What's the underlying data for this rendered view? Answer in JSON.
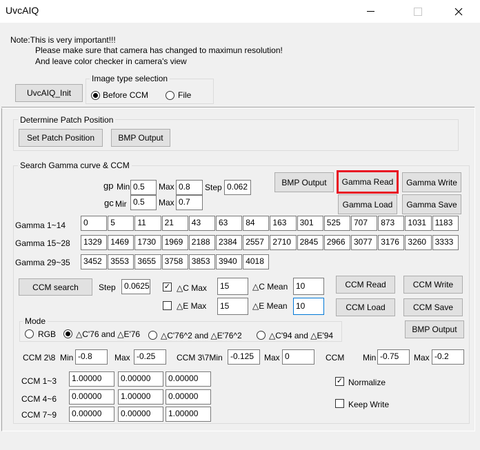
{
  "window": {
    "title": "UvcAIQ"
  },
  "note": {
    "line1": "Note:This is very important!!!",
    "line2": "Please make sure that camera has changed to maximun resolution!",
    "line3": "And leave color checker in camera's view"
  },
  "init_button": "UvcAIQ_Init",
  "image_type": {
    "title": "Image type selection",
    "before_ccm": "Before CCM",
    "file": "File"
  },
  "patch": {
    "title": "Determine Patch Position",
    "set_patch": "Set Patch Position",
    "bmp_output": "BMP Output"
  },
  "search": {
    "title": "Search Gamma curve & CCM",
    "gp_label": "gp",
    "gc_label": "gc",
    "min_label": "Min",
    "mir_label": "Mir",
    "max_label": "Max",
    "step_label": "Step",
    "gp_min": "0.5",
    "gp_max": "0.8",
    "step": "0.062",
    "gc_min": "0.5",
    "gc_max": "0.7",
    "bmp_output": "BMP Output",
    "gamma_read": "Gamma Read",
    "gamma_write": "Gamma Write",
    "gamma_load": "Gamma Load",
    "gamma_save": "Gamma Save"
  },
  "gamma": {
    "row1_label": "Gamma 1~14",
    "row2_label": "Gamma 15~28",
    "row3_label": "Gamma 29~35",
    "row1": [
      "0",
      "5",
      "11",
      "21",
      "43",
      "63",
      "84",
      "163",
      "301",
      "525",
      "707",
      "873",
      "1031",
      "1183"
    ],
    "row2": [
      "1329",
      "1469",
      "1730",
      "1969",
      "2188",
      "2384",
      "2557",
      "2710",
      "2845",
      "2966",
      "3077",
      "3176",
      "3260",
      "3333"
    ],
    "row3": [
      "3452",
      "3553",
      "3655",
      "3758",
      "3853",
      "3940",
      "4018"
    ]
  },
  "ccm": {
    "search_button": "CCM search",
    "step_label": "Step",
    "step": "0.0625",
    "c_max_label": "△C Max",
    "c_max": "15",
    "c_mean_label": "△C Mean",
    "c_mean": "10",
    "e_max_label": "△E Max",
    "e_max": "15",
    "e_mean_label": "△E Mean",
    "e_mean": "10",
    "ccm_read": "CCM Read",
    "ccm_write": "CCM Write",
    "ccm_load": "CCM Load",
    "ccm_save": "CCM Save",
    "bmp_output": "BMP Output"
  },
  "mode": {
    "title": "Mode",
    "rgb": "RGB",
    "opt76": "△C'76 and △E'76",
    "opt76sq": "△C'76^2 and △E'76^2",
    "opt94": "△C'94 and △E'94"
  },
  "limits": {
    "ccm28_label": "CCM 2\\8",
    "min_label": "Min",
    "max_label": "Max",
    "ccm28_min": "-0.8",
    "ccm28_max": "-0.25",
    "ccm37_label": "CCM 3\\7Min",
    "ccm37_min": "-0.125",
    "ccm37_max": "0",
    "ccm_label": "CCM",
    "ccm_min": "-0.75",
    "ccm_max": "-0.2"
  },
  "matrix": {
    "row1_label": "CCM 1~3",
    "row2_label": "CCM 4~6",
    "row3_label": "CCM 7~9",
    "row1": [
      "1.00000",
      "0.00000",
      "0.00000"
    ],
    "row2": [
      "0.00000",
      "1.00000",
      "0.00000"
    ],
    "row3": [
      "0.00000",
      "0.00000",
      "1.00000"
    ],
    "normalize": "Normalize",
    "keep_write": "Keep Write",
    "check_mark": "✓"
  },
  "colors": {
    "highlight": "#e81123"
  }
}
